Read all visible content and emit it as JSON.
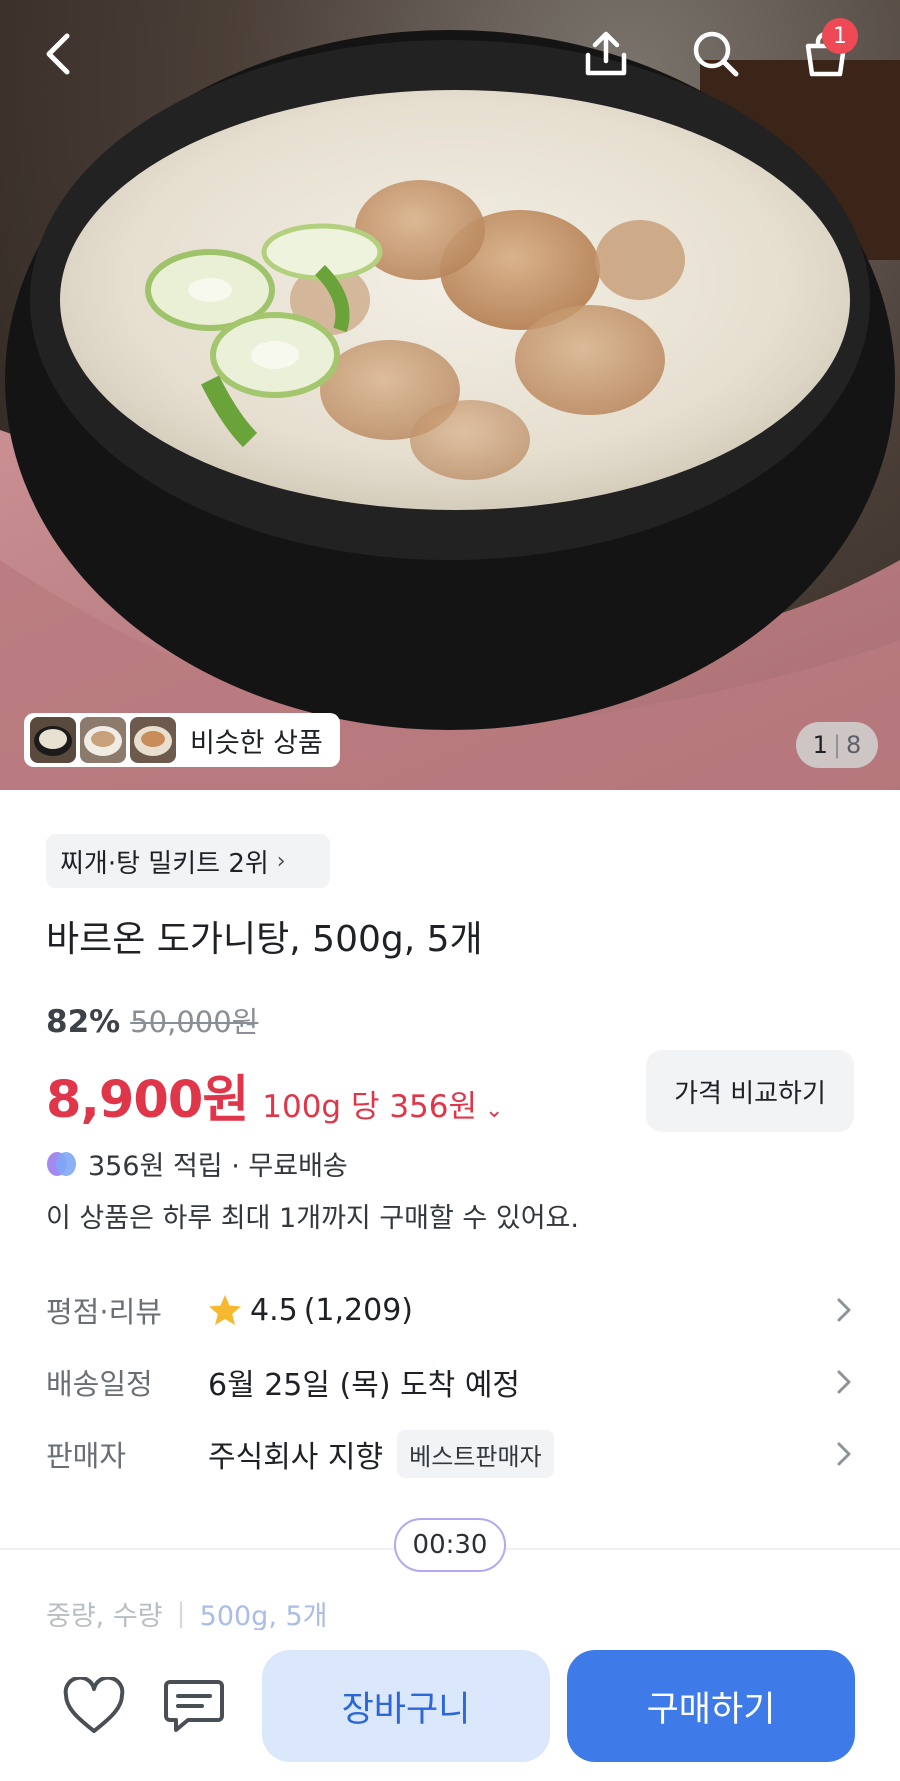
{
  "header": {
    "back_icon": "chevron-left-icon",
    "share_icon": "share-upload-icon",
    "search_icon": "search-icon",
    "cart_icon": "shopping-bag-icon",
    "cart_badge_count": "1"
  },
  "gallery": {
    "similar_products_label": "비슷한 상품",
    "current_page": "1",
    "total_pages": "8",
    "page_separator": "|"
  },
  "product": {
    "rank_badge": "찌개·탕 밀키트 2위",
    "rank_chevron": "›",
    "title": "바르온 도가니탕, 500g, 5개",
    "discount_rate": "82%",
    "original_price": "50,000원",
    "price": "8,900원",
    "unit_price": "100g 당 356원",
    "unit_price_chevron": "⌄",
    "compare_button": "가격 비교하기",
    "reward_text": "356원 적립 · 무료배송",
    "purchase_limit": "이 상품은 하루 최대 1개까지 구매할 수 있어요."
  },
  "details": {
    "rating": {
      "label": "평점·리뷰",
      "score": "4.5",
      "review_count": "(1,209)"
    },
    "delivery": {
      "label": "배송일정",
      "value": "6월 25일 (목) 도착 예정"
    },
    "seller": {
      "label": "판매자",
      "value": "주식회사 지향",
      "badge": "베스트판매자"
    },
    "weight": {
      "label": "중량, 수량",
      "separator": "|",
      "value": "500g, 5개"
    }
  },
  "timer": "00:30",
  "bottom_bar": {
    "wishlist_icon": "heart-icon",
    "inquiry_icon": "chat-icon",
    "cart_button": "장바구니",
    "buy_button": "구매하기"
  },
  "colors": {
    "price_red": "#e0364a",
    "accent_blue": "#3f7be8",
    "light_blue": "#dbe7fb",
    "badge_red": "#ee4a56",
    "star_yellow": "#f5b82e"
  }
}
